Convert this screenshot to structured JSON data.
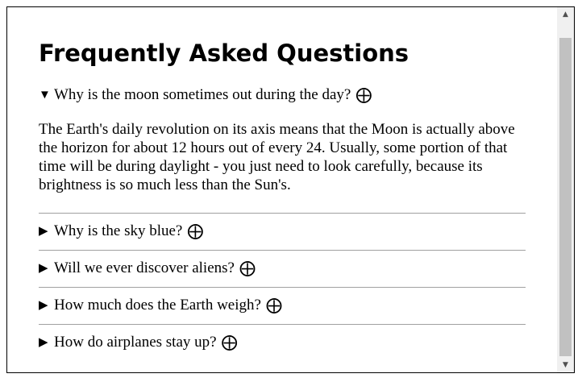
{
  "page": {
    "title": "Frequently Asked Questions"
  },
  "faq": {
    "items": [
      {
        "question": "Why is the moon sometimes out during the day?",
        "expanded": true,
        "answer": "The Earth's daily revolution on its axis means that the Moon is actually above the horizon for about 12 hours out of every 24. Usually, some portion of that time will be during daylight - you just need to look carefully, because its brightness is so much less than the Sun's."
      },
      {
        "question": "Why is the sky blue?",
        "expanded": false
      },
      {
        "question": "Will we ever discover aliens?",
        "expanded": false
      },
      {
        "question": "How much does the Earth weigh?",
        "expanded": false
      },
      {
        "question": "How do airplanes stay up?",
        "expanded": false
      }
    ]
  },
  "glyphs": {
    "expanded_marker": "▼",
    "collapsed_marker": "▶",
    "toggle_icon": "⨁",
    "scroll_up": "▲",
    "scroll_down": "▼"
  }
}
